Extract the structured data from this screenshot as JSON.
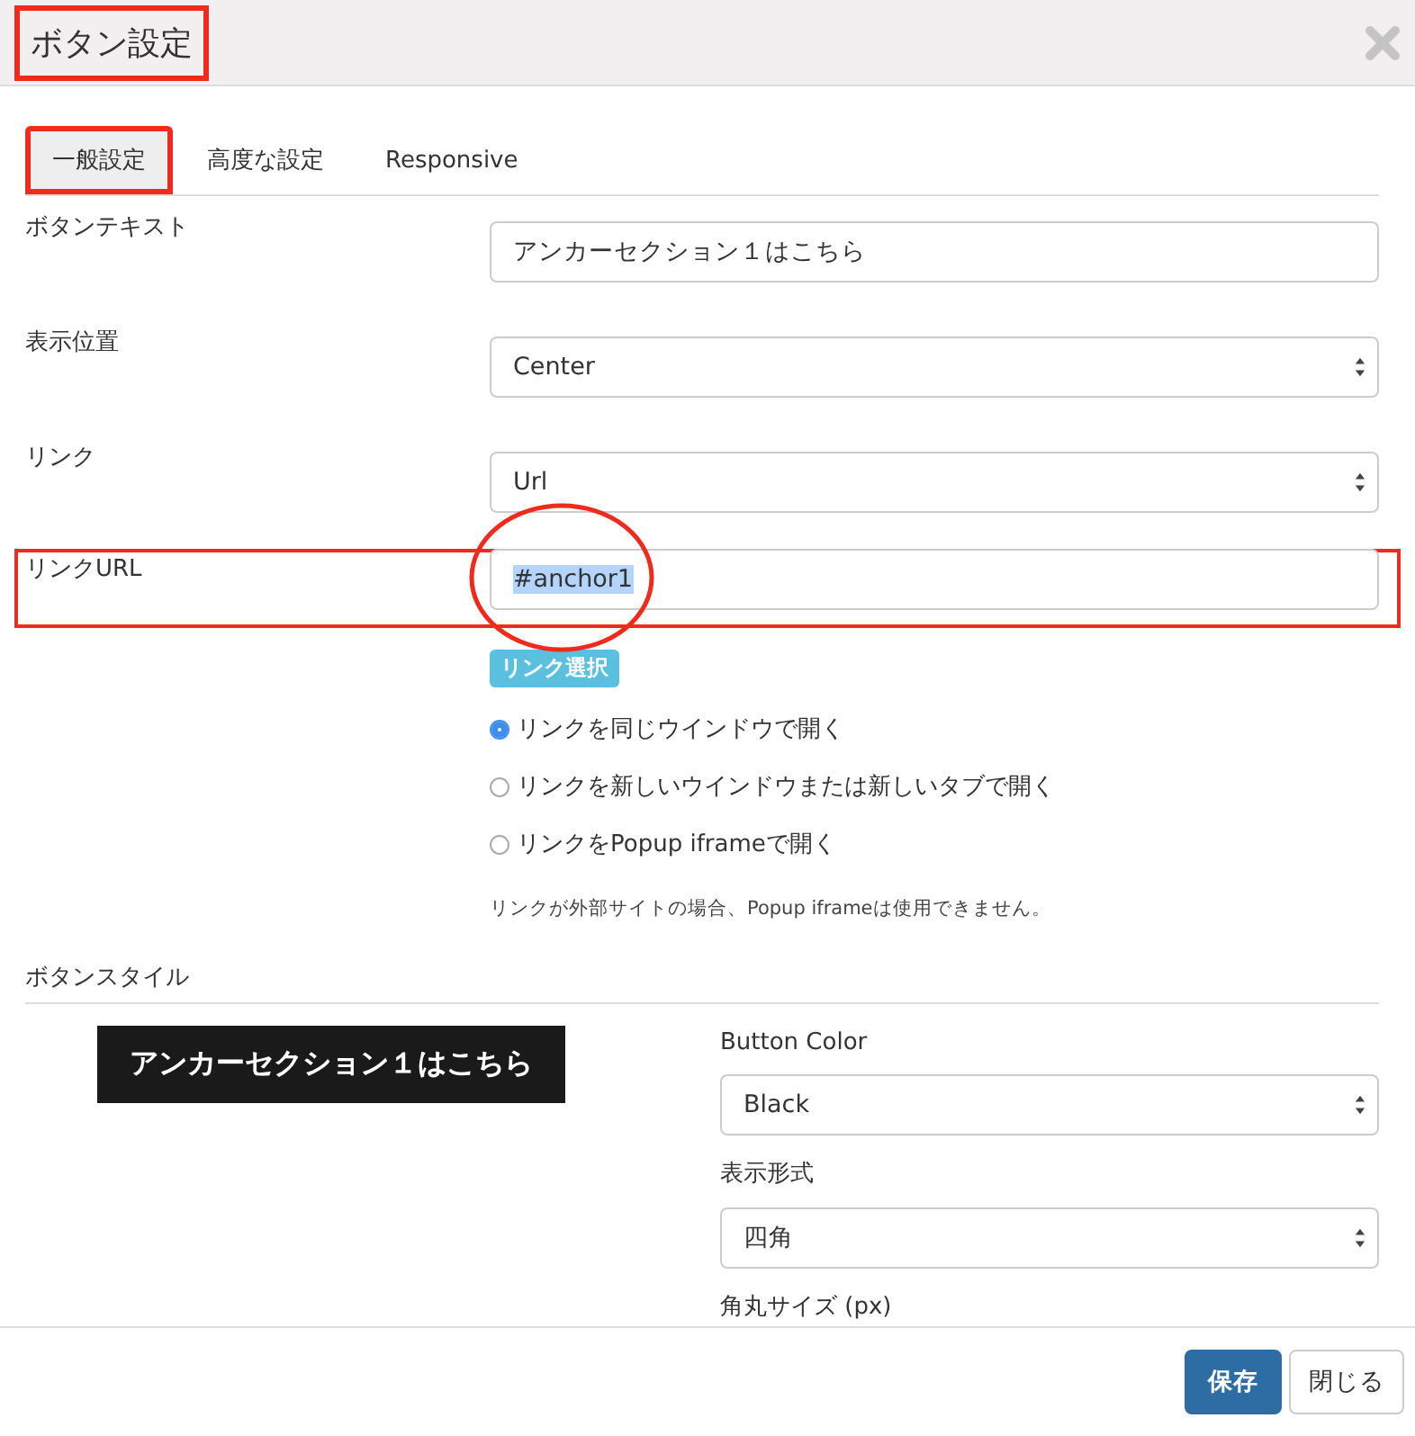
{
  "dialog": {
    "title": "ボタン設定",
    "title_highlighted": true
  },
  "tabs": [
    {
      "label": "一般設定",
      "selected": true,
      "highlighted": true
    },
    {
      "label": "高度な設定",
      "selected": false,
      "highlighted": false
    },
    {
      "label": "Responsive",
      "selected": false,
      "highlighted": false
    }
  ],
  "fields": [
    {
      "label": "ボタンテキスト",
      "kind": "text",
      "value": "アンカーセクション１はこちら"
    },
    {
      "label": "表示位置",
      "kind": "select",
      "value": "Center"
    },
    {
      "label": "リンク",
      "kind": "select",
      "value": "Url"
    },
    {
      "label": "リンクURL",
      "kind": "text",
      "value": "#anchor1",
      "highlighted": true,
      "circled": true,
      "value_selected": true
    }
  ],
  "link_pick_button": "リンク選択",
  "link_targets": [
    {
      "label": "リンクを同じウインドウで開く",
      "selected": true
    },
    {
      "label": "リンクを新しいウインドウまたは新しいタブで開く",
      "selected": false
    },
    {
      "label": "リンクをPopup iframeで開く",
      "selected": false
    }
  ],
  "note": "リンクが外部サイトの場合、Popup iframeは使用できません。",
  "style_section": {
    "heading": "ボタンスタイル",
    "preview_button": "アンカーセクション１はこちら",
    "fields": [
      {
        "label": "Button Color",
        "value": "Black"
      },
      {
        "label": "表示形式",
        "value": "四角"
      }
    ],
    "cut_label": "角丸サイズ (px)"
  },
  "footer_buttons": [
    {
      "label": "保存",
      "kind": "primary"
    },
    {
      "label": "閉じる",
      "kind": "default"
    }
  ]
}
